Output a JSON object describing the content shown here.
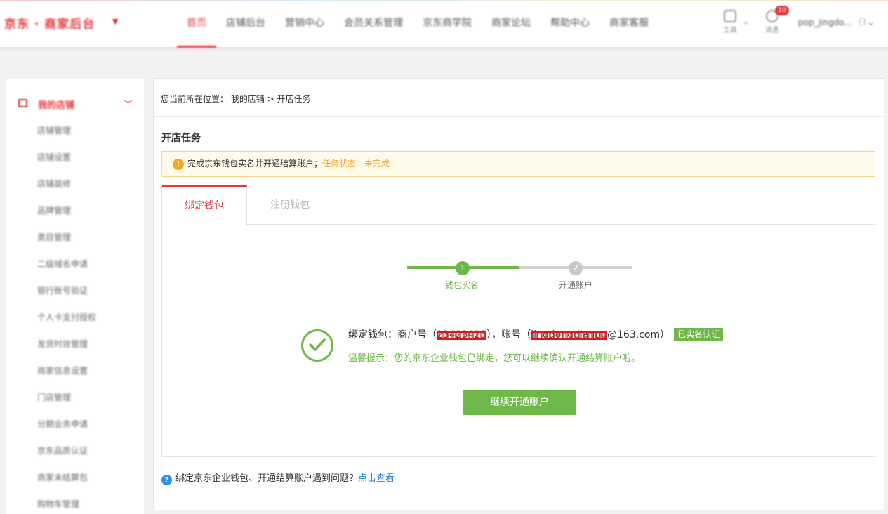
{
  "header": {
    "logo": "京东 · 商家后台",
    "nav": [
      "首页",
      "店铺后台",
      "营销中心",
      "会员关系管理",
      "京东商学院",
      "商家论坛",
      "帮助中心",
      "商家客服"
    ],
    "tools_label": "工具",
    "messages_label": "消息",
    "messages_badge": "10",
    "username": "pop_jingdo..."
  },
  "sidebar": {
    "section": "我的店铺",
    "items": [
      "店铺管理",
      "店铺设置",
      "店铺装修",
      "品牌管理",
      "类目管理",
      "二级域名申请",
      "银行账号验证",
      "个人卡支付授权",
      "发货时效管理",
      "商家信息设置",
      "门店管理",
      "分期业务申请",
      "京东品质认证",
      "商家未结算包",
      "购物车管理"
    ]
  },
  "breadcrumb": {
    "prefix": "您当前所在位置：",
    "path": "我的店铺 > 开店任务"
  },
  "page_title": "开店任务",
  "notice": {
    "text": "完成京东钱包实名并开通结算账户；",
    "status": "任务状态：未完成"
  },
  "tabs": [
    "绑定钱包",
    "注册钱包"
  ],
  "steps": [
    {
      "num": "1",
      "label": "钱包实名"
    },
    {
      "num": "2",
      "label": "开通账户"
    }
  ],
  "bind": {
    "prefix": "绑定钱包：商户号（",
    "merchant_id": "23423423",
    "middle": "），账号（",
    "account_user": "jingdongdianpu",
    "account_domain": "@163.com",
    "suffix": "）",
    "badge": "已实名认证"
  },
  "tip": "温馨提示：您的京东企业钱包已绑定，您可以继续确认开通结算账户啦。",
  "continue_button": "继续开通账户",
  "help": {
    "text": "绑定京东企业钱包、开通结算账户遇到问题？",
    "link": "点击查看"
  }
}
